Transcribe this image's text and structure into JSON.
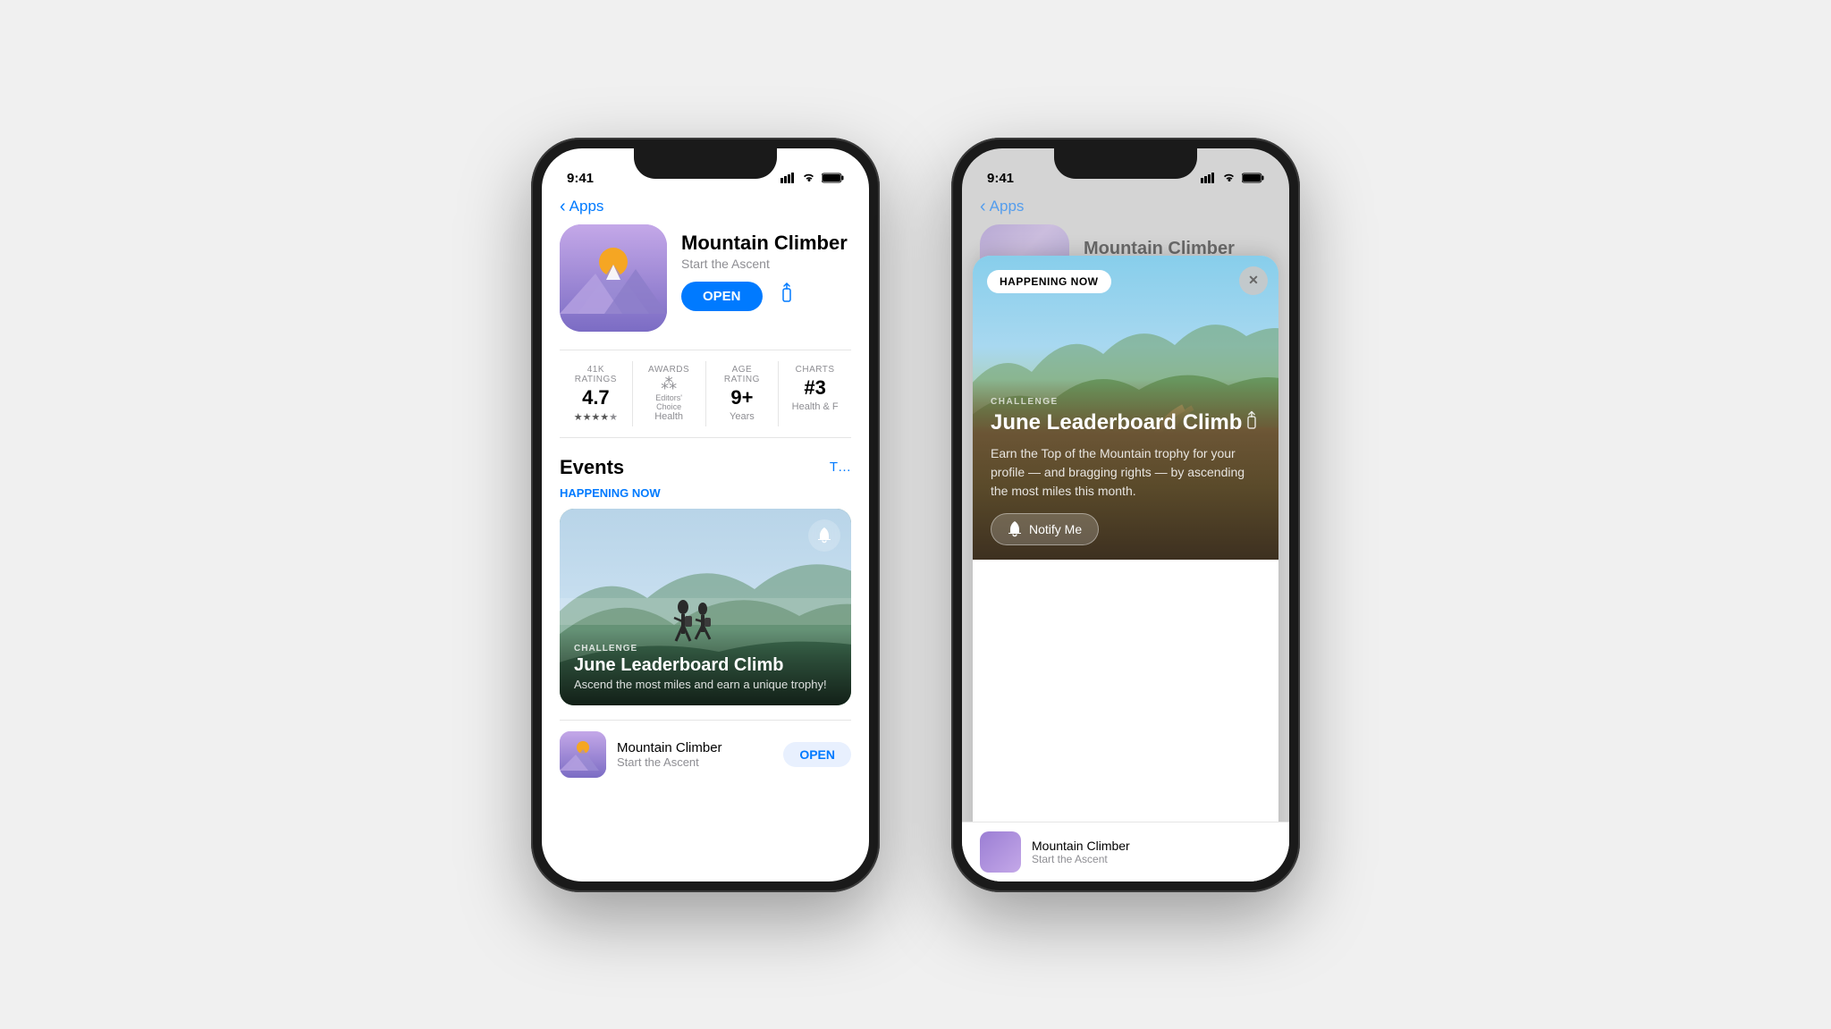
{
  "background": "#f0f0f0",
  "phone1": {
    "status": {
      "time": "9:41",
      "signal": "▌▌▌",
      "wifi": "WiFi",
      "battery": "Battery"
    },
    "nav": {
      "back_label": "Apps"
    },
    "app": {
      "name": "Mountain Climber",
      "subtitle": "Start the Ascent",
      "open_btn": "OPEN",
      "ratings": {
        "count_label": "41K RATINGS",
        "count_value": "4.7",
        "stars": "★★★★☆",
        "awards_label": "AWARDS",
        "awards_value": "Editors' Choice",
        "awards_sub": "Health",
        "age_label": "AGE RATING",
        "age_value": "9+",
        "age_sub": "Years",
        "charts_label": "CHARTS",
        "charts_value": "#3",
        "charts_sub": "Health & F"
      },
      "events_section": "Events",
      "happening_now": "HAPPENING NOW",
      "event": {
        "type": "CHALLENGE",
        "name": "June Leaderboard Climb",
        "desc": "Ascend the most miles and earn a unique trophy!"
      },
      "bottom_row": {
        "name": "Mountain Climber",
        "sub": "Start the Ascent",
        "open": "OPEN"
      }
    }
  },
  "phone2": {
    "status": {
      "time": "9:41",
      "signal": "▌▌▌",
      "wifi": "WiFi",
      "battery": "Battery"
    },
    "nav": {
      "back_label": "Apps"
    },
    "bg_app_name": "Mountain Climber",
    "overlay": {
      "happening_now_badge": "HAPPENING NOW",
      "close_btn": "✕",
      "event": {
        "type": "CHALLENGE",
        "title": "June Leaderboard Climb",
        "desc": "Earn the Top of the Mountain trophy for your profile — and bragging rights — by ascending the most miles this month.",
        "notify_btn": "Notify Me"
      }
    }
  }
}
